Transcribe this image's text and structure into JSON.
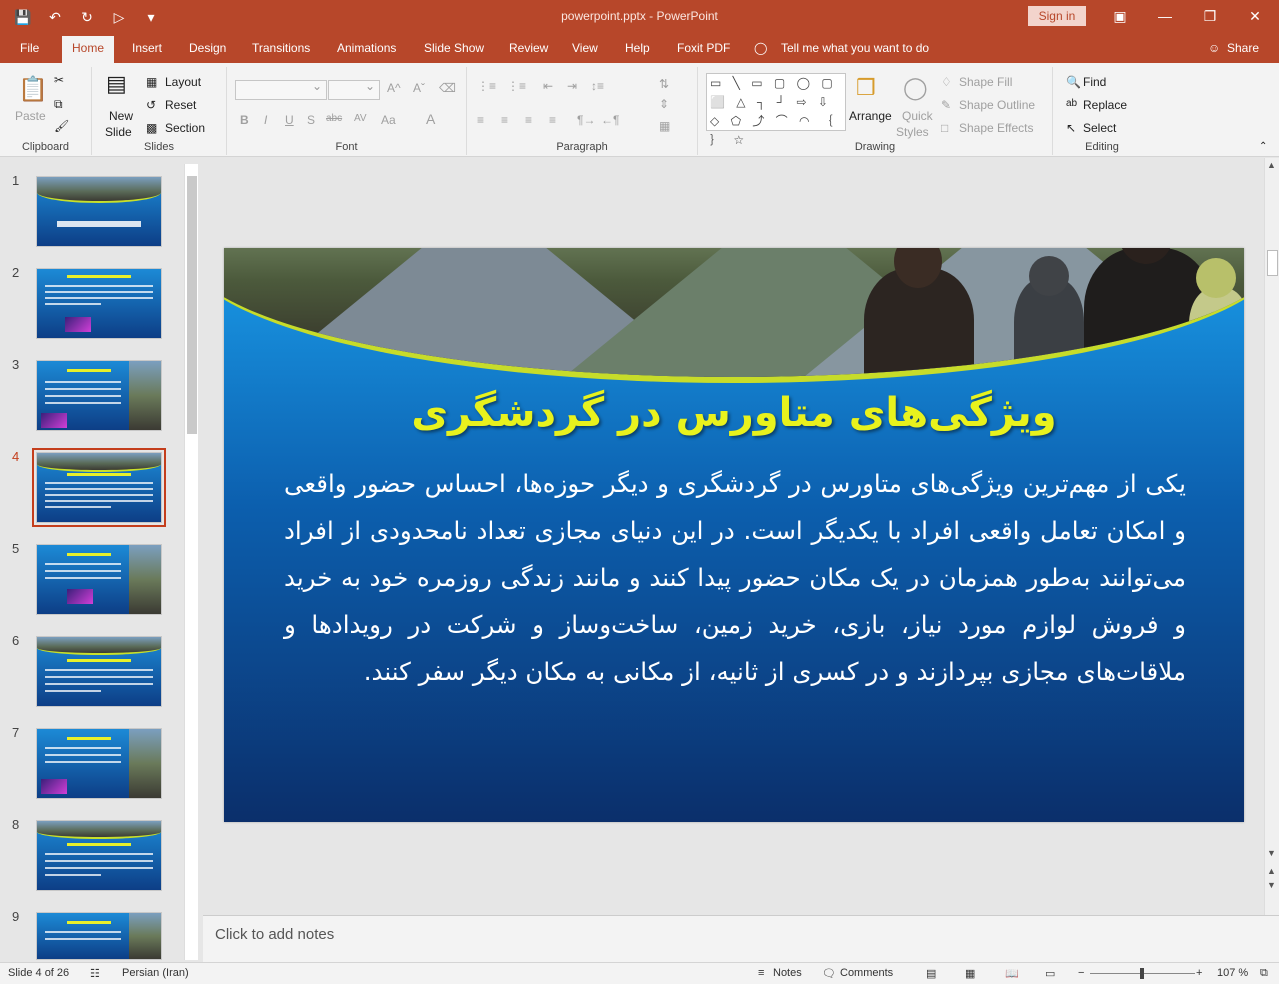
{
  "app": {
    "title": "powerpoint.pptx  -  PowerPoint",
    "signin": "Sign in",
    "tellme": "Tell me what you want to do",
    "share": "Share"
  },
  "tabs": [
    "File",
    "Home",
    "Insert",
    "Design",
    "Transitions",
    "Animations",
    "Slide Show",
    "Review",
    "View",
    "Help",
    "Foxit PDF"
  ],
  "ribbon": {
    "clipboard": {
      "label": "Clipboard",
      "paste": "Paste"
    },
    "slides": {
      "label": "Slides",
      "new_slide_1": "New",
      "new_slide_2": "Slide",
      "layout": "Layout",
      "reset": "Reset",
      "section": "Section"
    },
    "font": {
      "label": "Font",
      "bold": "B",
      "italic": "I",
      "underline": "U",
      "shadow": "S",
      "strike": "abc",
      "spacing": "AV",
      "case": "Aa",
      "color": "A"
    },
    "paragraph": {
      "label": "Paragraph"
    },
    "drawing": {
      "label": "Drawing",
      "shapes": "▭ ╲ ▭ ▢ ◯ ▢ ⬜ △ ┐ ┘ ⇨ ⇩ ◇ ⬠ ⤴ ⌒ ◠ ｛ ｝ ☆",
      "arrange": "Arrange",
      "quick_styles_1": "Quick",
      "quick_styles_2": "Styles",
      "shape_fill": "Shape Fill",
      "shape_outline": "Shape Outline",
      "shape_effects": "Shape Effects"
    },
    "editing": {
      "label": "Editing",
      "find": "Find",
      "replace": "Replace",
      "select": "Select"
    }
  },
  "slides_panel": {
    "numbers": [
      "1",
      "2",
      "3",
      "4",
      "5",
      "6",
      "7",
      "8",
      "9"
    ],
    "active_index": 4
  },
  "slide": {
    "title": "ویژگی‌های متاورس در گردشگری",
    "body": "یکی از مهم‌ترین ویژگی‌های متاورس در گردشگری و دیگر حوزه‌ها، احساس حضور واقعی و امکان تعامل واقعی افراد با یکدیگر است. در این دنیای مجازی تعداد نامحدودی از افراد می‌توانند به‌طور همزمان در یک مکان حضور پیدا کنند و مانند زندگی روزمره خود به خرید و فروش لوازم مورد نیاز، بازی، خرید زمین، ساخت‌وساز و شرکت در رویدادها و ملاقات‌های مجازی بپردازند و در کسری از ثانیه، از مکانی به مکان دیگر سفر کنند."
  },
  "notes": {
    "placeholder": "Click to add notes"
  },
  "status": {
    "slide_counter": "Slide 4 of 26",
    "language": "Persian (Iran)",
    "notes": "Notes",
    "comments": "Comments",
    "zoom": "107 %"
  },
  "colors": {
    "accent": "#b7472a",
    "slide_title": "#e8f21d",
    "active_thumb": "#c43e1c"
  }
}
